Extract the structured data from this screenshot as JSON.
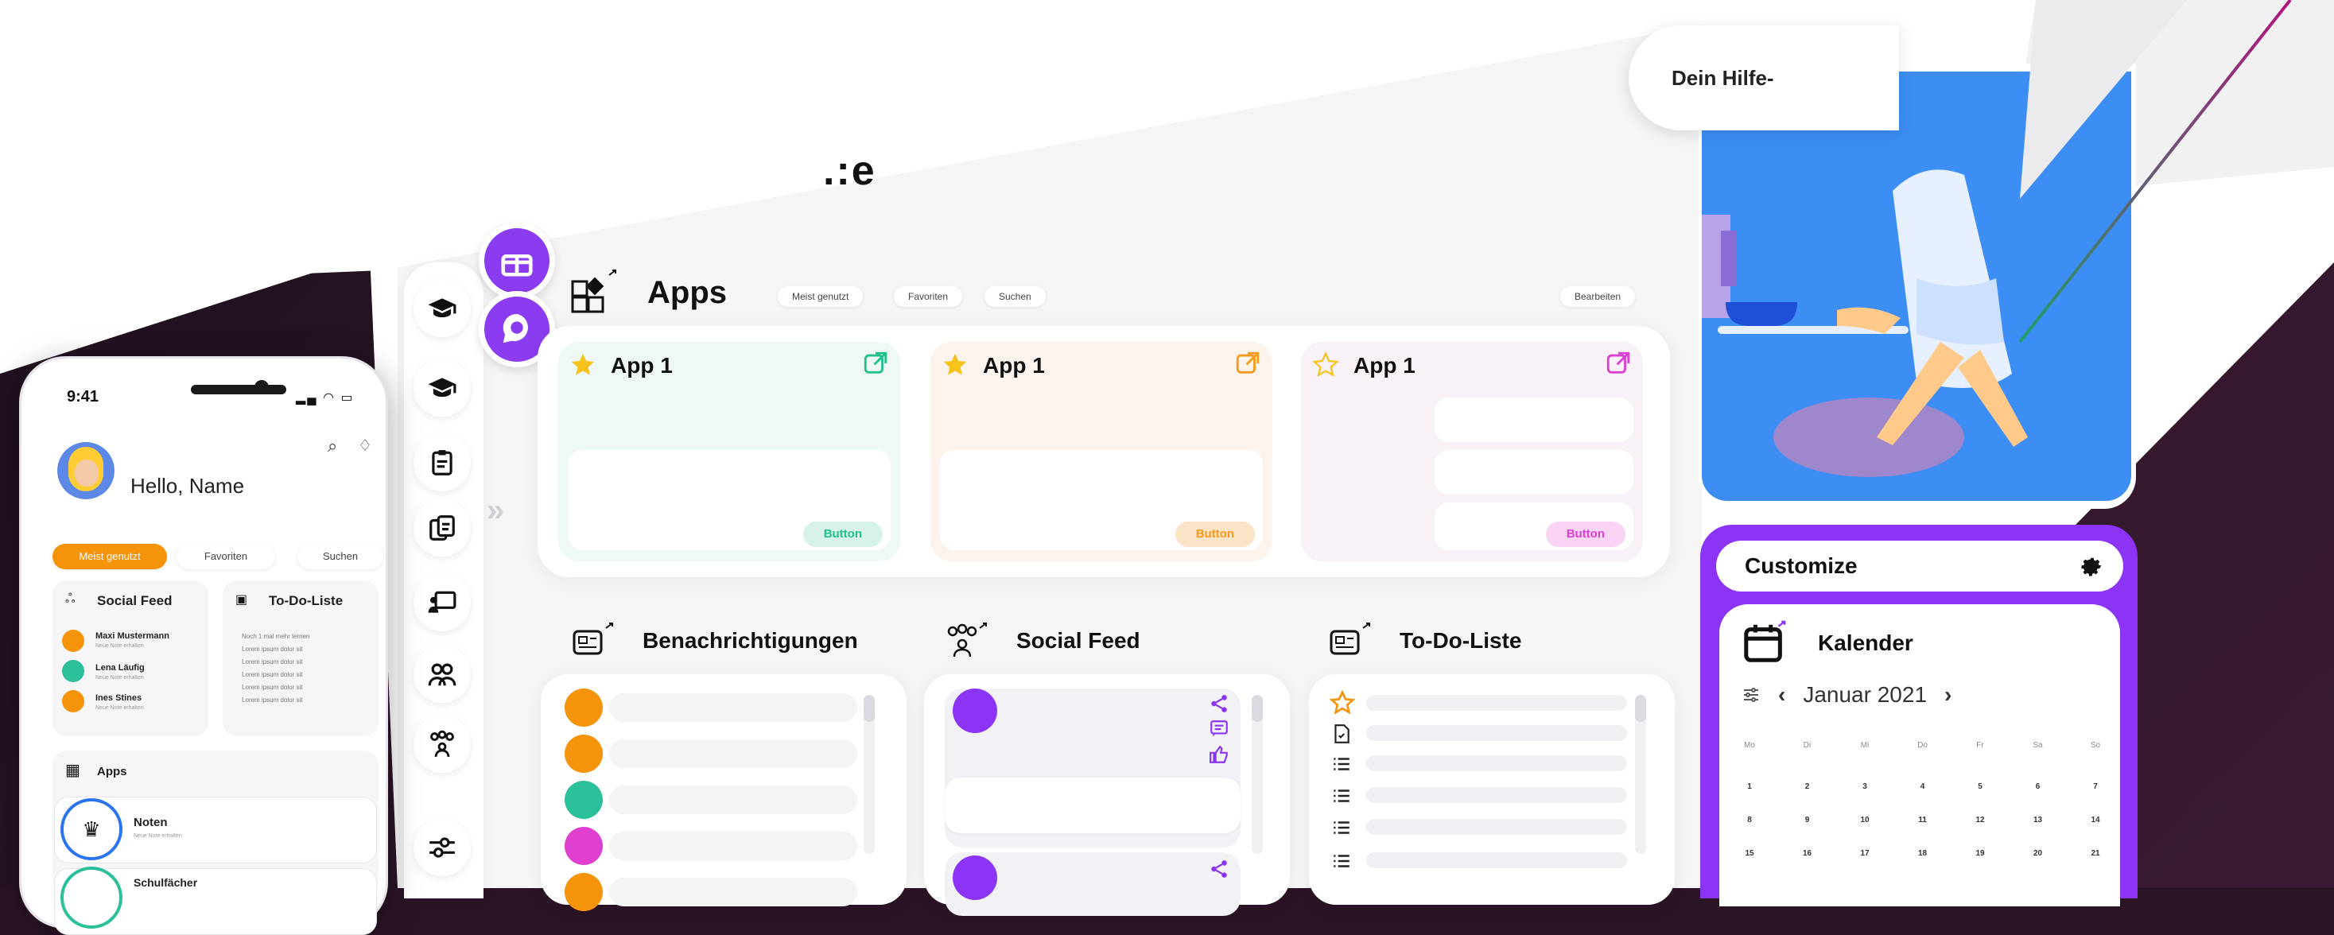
{
  "help": {
    "text": "Dein Hilfe-"
  },
  "page_title_fragment": ".:e",
  "apps": {
    "title": "Apps",
    "pills": [
      "Meist genutzt",
      "Favoriten",
      "Suchen"
    ],
    "edit": "Bearbeiten",
    "cards": [
      {
        "name": "App 1",
        "button": "Button",
        "color": "#eef8f4",
        "accent": "#21c08a"
      },
      {
        "name": "App 1",
        "button": "Button",
        "color": "#fbf3ec",
        "accent": "#f59a1b"
      },
      {
        "name": "App 1",
        "button": "Button",
        "color": "#f9f1f8",
        "accent": "#d940d0"
      }
    ]
  },
  "sections": {
    "notifications": "Benachrichtigungen",
    "social": "Social Feed",
    "todo": "To-Do-Liste"
  },
  "customize": {
    "title": "Customize"
  },
  "calendar": {
    "title": "Kalender",
    "month": "Januar 2021",
    "weekdays": [
      "Mo",
      "Di",
      "Mi",
      "Do",
      "Fr",
      "Sa",
      "So"
    ],
    "days": [
      "1",
      "2",
      "3",
      "4",
      "5",
      "6",
      "7",
      "8",
      "9",
      "10",
      "11",
      "12",
      "13",
      "14",
      "15",
      "16",
      "17",
      "18",
      "19",
      "20",
      "21"
    ]
  },
  "phone": {
    "time": "9:41",
    "greeting": "Hello, Name",
    "tabs": [
      "Meist genutzt",
      "Favoriten",
      "Suchen"
    ],
    "social_title": "Social Feed",
    "todo_title": "To-Do-Liste",
    "people": [
      {
        "name": "Maxi Mustermann",
        "sub": "Neue Note erhalten"
      },
      {
        "name": "Lena Läufig",
        "sub": "Neue Note erhalten"
      },
      {
        "name": "Ines Stines",
        "sub": "Neue Note erhalten"
      }
    ],
    "todos": [
      "Noch 1 mal mehr lernen",
      "Lorem ipsum dolor sit",
      "Lorem ipsum dolor sit",
      "Lorem ipsum dolor sit",
      "Lorem ipsum dolor sit",
      "Lorem ipsum dolor sit"
    ],
    "apps_title": "Apps",
    "app_items": [
      {
        "name": "Noten",
        "sub": "Neue Note erhalten"
      },
      {
        "name": "Schulfächer",
        "sub": ""
      }
    ]
  },
  "colors": {
    "purple": "#8b34f5",
    "orange": "#f5930a",
    "teal": "#2bbf9a",
    "magenta": "#e040d0",
    "blue": "#3c8ef5"
  }
}
